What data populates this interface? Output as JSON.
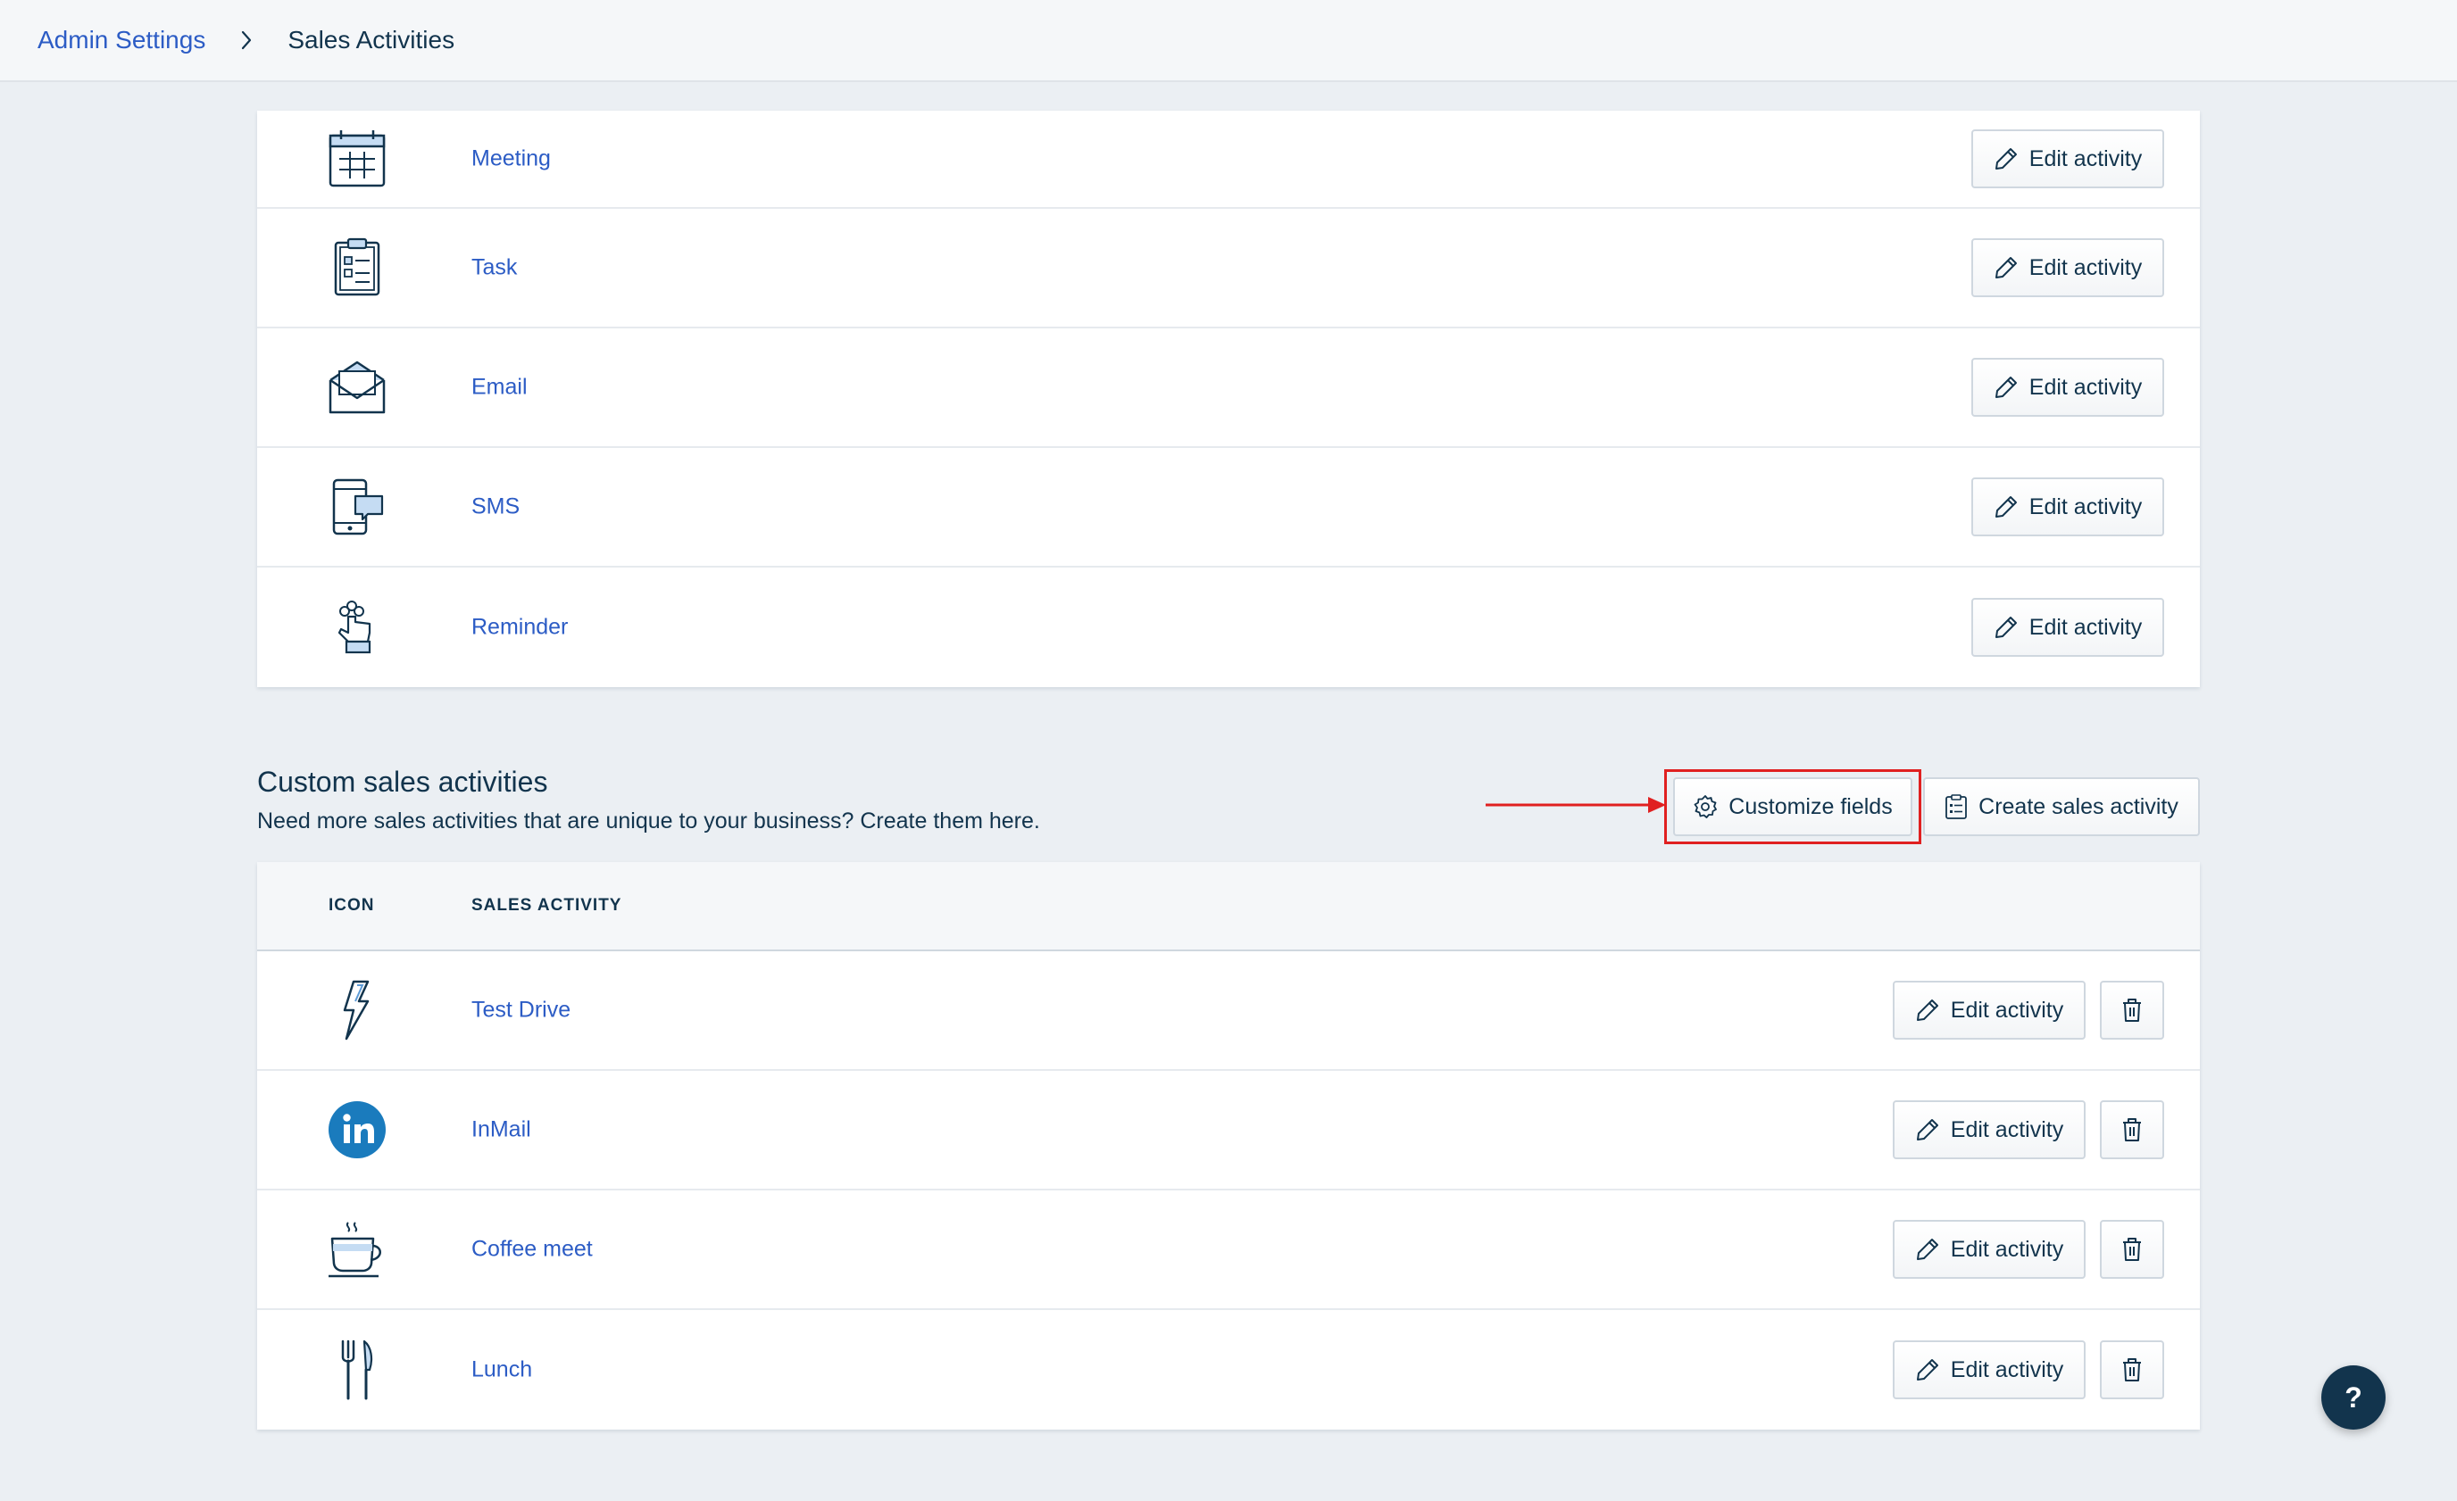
{
  "breadcrumb": {
    "parent": "Admin Settings",
    "current": "Sales Activities"
  },
  "default_activities": [
    {
      "label": "Meeting",
      "icon": "calendar-icon",
      "action": "Edit activity"
    },
    {
      "label": "Task",
      "icon": "clipboard-icon",
      "action": "Edit activity"
    },
    {
      "label": "Email",
      "icon": "envelope-icon",
      "action": "Edit activity"
    },
    {
      "label": "SMS",
      "icon": "phone-message-icon",
      "action": "Edit activity"
    },
    {
      "label": "Reminder",
      "icon": "finger-string-icon",
      "action": "Edit activity"
    }
  ],
  "custom_section": {
    "title": "Custom sales activities",
    "subtitle": "Need more sales activities that are unique to your business? Create them here.",
    "customize_label": "Customize fields",
    "create_label": "Create sales activity",
    "highlight_color": "#e02020"
  },
  "custom_table": {
    "headers": {
      "icon": "ICON",
      "activity": "SALES ACTIVITY"
    },
    "rows": [
      {
        "label": "Test Drive",
        "icon": "lightning-icon",
        "action": "Edit activity"
      },
      {
        "label": "InMail",
        "icon": "linkedin-icon",
        "action": "Edit activity"
      },
      {
        "label": "Coffee meet",
        "icon": "coffee-cup-icon",
        "action": "Edit activity"
      },
      {
        "label": "Lunch",
        "icon": "fork-knife-icon",
        "action": "Edit activity"
      }
    ]
  },
  "help": {
    "label": "?"
  },
  "colors": {
    "link": "#2c5cc5",
    "text": "#12344d",
    "background": "#ebeff3",
    "linkedin": "#1a7bbd"
  }
}
